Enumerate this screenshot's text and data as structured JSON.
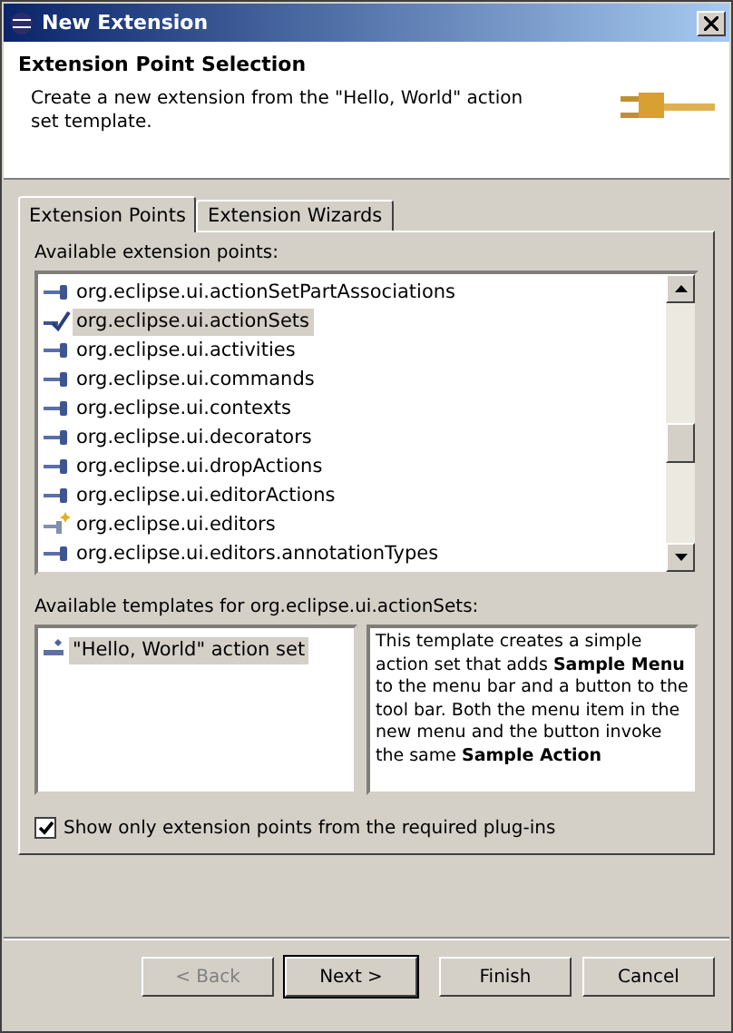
{
  "window": {
    "title": "New Extension"
  },
  "header": {
    "title": "Extension Point Selection",
    "description": "Create a new extension from the \"Hello, World\" action set template."
  },
  "tabs": [
    {
      "label": "Extension Points",
      "selected": true
    },
    {
      "label": "Extension Wizards",
      "selected": false
    }
  ],
  "points_label": "Available extension points:",
  "extension_points": [
    {
      "label": "org.eclipse.ui.actionSetPartAssociations",
      "kind": "plug",
      "selected": false
    },
    {
      "label": "org.eclipse.ui.actionSets",
      "kind": "checked",
      "selected": true
    },
    {
      "label": "org.eclipse.ui.activities",
      "kind": "plug",
      "selected": false
    },
    {
      "label": "org.eclipse.ui.commands",
      "kind": "plug",
      "selected": false
    },
    {
      "label": "org.eclipse.ui.contexts",
      "kind": "plug",
      "selected": false
    },
    {
      "label": "org.eclipse.ui.decorators",
      "kind": "plug",
      "selected": false
    },
    {
      "label": "org.eclipse.ui.dropActions",
      "kind": "plug",
      "selected": false
    },
    {
      "label": "org.eclipse.ui.editorActions",
      "kind": "plug",
      "selected": false
    },
    {
      "label": "org.eclipse.ui.editors",
      "kind": "starred",
      "selected": false
    },
    {
      "label": "org.eclipse.ui.editors.annotationTypes",
      "kind": "plug",
      "selected": false
    }
  ],
  "templates_label": "Available templates for org.eclipse.ui.actionSets:",
  "templates": [
    {
      "label": "\"Hello, World\" action set",
      "selected": true
    }
  ],
  "template_description": "This template creates a simple action set that adds **Sample Menu** to the menu bar and a button to the tool bar. Both the menu item in the new menu and the button invoke the same **Sample Action**",
  "filter_checkbox": {
    "label": "Show only extension points from the required plug-ins",
    "checked": true
  },
  "buttons": [
    {
      "label": "< Back",
      "disabled": true,
      "default": false
    },
    {
      "label": "Next >",
      "disabled": false,
      "default": true
    },
    {
      "label": "Finish",
      "disabled": false,
      "default": false
    },
    {
      "label": "Cancel",
      "disabled": false,
      "default": false
    }
  ]
}
